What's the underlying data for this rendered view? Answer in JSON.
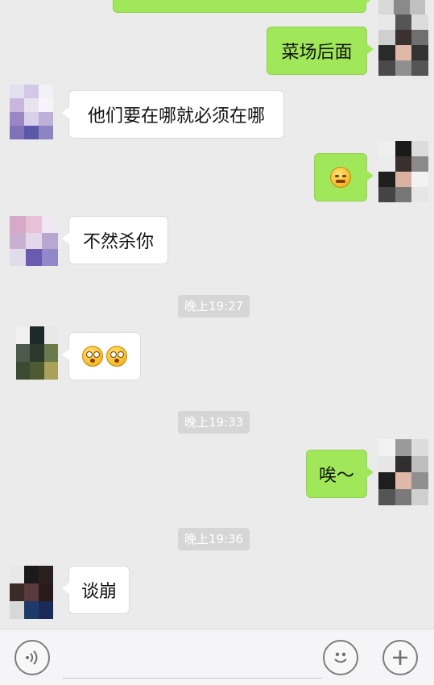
{
  "messages": [
    {
      "side": "right",
      "text": "菜场后面"
    },
    {
      "side": "left",
      "text": "他们要在哪就必须在哪"
    },
    {
      "side": "right",
      "emoji": "smirk-emoji"
    },
    {
      "side": "left",
      "text": "不然杀你"
    },
    {
      "timestamp": "晚上19:27"
    },
    {
      "side": "left",
      "emoji": "flushed-emoji-x2"
    },
    {
      "timestamp": "晚上19:33"
    },
    {
      "side": "right",
      "text": "唉～"
    },
    {
      "timestamp": "晚上19:36"
    },
    {
      "side": "left",
      "text": "谈崩"
    }
  ],
  "chat": {
    "msg1": "菜场后面",
    "msg2": "他们要在哪就必须在哪",
    "msg4": "不然杀你",
    "msg7": "唉～",
    "msg9": "谈崩"
  },
  "timestamps": {
    "t1": "晚上19:27",
    "t2": "晚上19:33",
    "t3": "晚上19:36"
  },
  "input_bar": {
    "voice_icon": "voice-icon",
    "emoji_icon": "emoji-icon",
    "plus_icon": "plus-icon",
    "input_value": ""
  },
  "colors": {
    "sent_bubble": "#a0e75a",
    "received_bubble": "#ffffff",
    "background": "#ebebeb",
    "timestamp_bg": "#d6d6d6"
  }
}
